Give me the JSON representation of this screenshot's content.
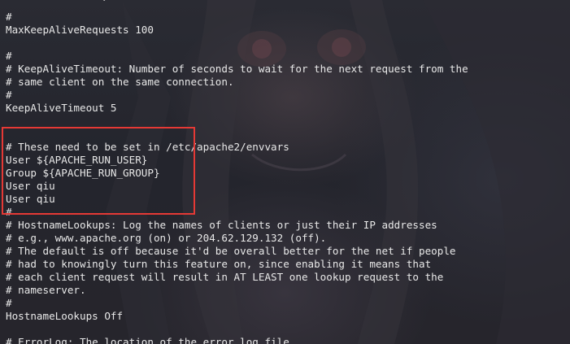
{
  "window": {
    "type": "terminal",
    "scroll_indicator": "chevron-down-icon"
  },
  "content": {
    "lines": [
      "#",
      "MaxKeepAliveRequests 100",
      "",
      "#",
      "# KeepAliveTimeout: Number of seconds to wait for the next request from the",
      "# same client on the same connection.",
      "#",
      "KeepAliveTimeout 5",
      "",
      "",
      "# These need to be set in /etc/apache2/envvars",
      "User ${APACHE_RUN_USER}",
      "Group ${APACHE_RUN_GROUP}",
      "User qiu",
      "User qiu",
      "#",
      "# HostnameLookups: Log the names of clients or just their IP addresses",
      "# e.g., www.apache.org (on) or 204.62.129.132 (off).",
      "# The default is off because it'd be overall better for the net if people",
      "# had to knowingly turn this feature on, since enabling it means that",
      "# each client request will result in AT LEAST one lookup request to the",
      "# nameserver.",
      "#",
      "HostnameLookups Off",
      "",
      "# ErrorLog: The location of the error log file."
    ]
  },
  "annotation": {
    "color": "#e53935"
  }
}
